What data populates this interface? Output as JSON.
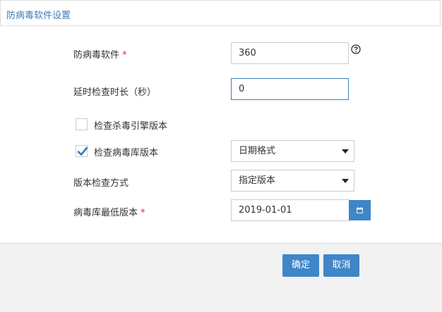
{
  "dialog": {
    "title": "防病毒软件设置"
  },
  "form": {
    "antivirus": {
      "label": "防病毒软件",
      "required_mark": "*",
      "value": "360",
      "help_icon": "question-circle-icon"
    },
    "delay": {
      "label": "延时检查时长（秒）",
      "value": "0"
    },
    "check_engine": {
      "label": "检查杀毒引擎版本",
      "checked": false
    },
    "check_db": {
      "label": "检查病毒库版本",
      "checked": true,
      "select_value": "日期格式"
    },
    "version_method": {
      "label": "版本检查方式",
      "select_value": "指定版本"
    },
    "min_db_version": {
      "label": "病毒库最低版本",
      "required_mark": "*",
      "value": "2019-01-01",
      "button_icon": "calendar-icon"
    }
  },
  "footer": {
    "confirm_label": "确定",
    "cancel_label": "取消"
  },
  "colors": {
    "accent": "#3f86c8",
    "title": "#3c7fb8",
    "required": "#d9302b",
    "footer_bg": "#f2f2f2"
  }
}
